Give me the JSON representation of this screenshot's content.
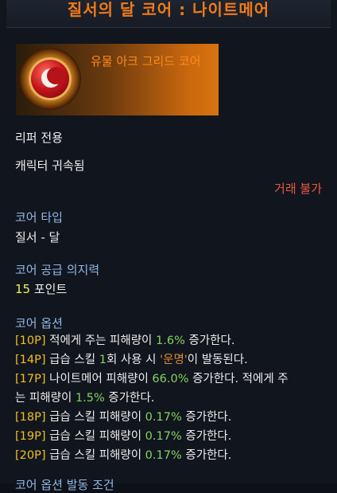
{
  "tooltip": {
    "title": "질서의 달 코어 : 나이트메어",
    "grade": "유물 아크 그리드 코어",
    "class_restriction": "리퍼 전용",
    "binding": "캐릭터 귀속됨",
    "trade": "거래 불가",
    "core_type_label": "코어 타입",
    "core_type_value": "질서 - 달",
    "willpower_label": "코어 공급 의지력",
    "willpower_value": "15",
    "willpower_unit": " 포인트",
    "options_label": "코어 옵션",
    "options": [
      {
        "tier": "[10P]",
        "pre": " 적에게 주는 피해량이 ",
        "num": "1.6%",
        "post": " 증가한다."
      },
      {
        "tier": "[14P]",
        "pre": " 급습 스킬 ",
        "num": "1",
        "mid": "회 사용 시 ",
        "quote": "'운명'",
        "post": "이 발동된다."
      },
      {
        "tier": "[17P]",
        "pre": " 나이트메어 피해량이 ",
        "num": "66.0%",
        "post": " 증가한다. 적에게 주",
        "line2_pre": "는 피해량이 ",
        "num2": "1.5%",
        "line2_post": " 증가한다."
      },
      {
        "tier": "[18P]",
        "pre": " 급습 스킬 피해량이 ",
        "num": "0.17%",
        "post": " 증가한다."
      },
      {
        "tier": "[19P]",
        "pre": " 급습 스킬 피해량이 ",
        "num": "0.17%",
        "post": " 증가한다."
      },
      {
        "tier": "[20P]",
        "pre": " 급습 스킬 피해량이 ",
        "num": "0.17%",
        "post": " 증가한다."
      }
    ],
    "next_section_label": "코어 옵션 발동 조건"
  },
  "colors": {
    "title": "#f07a1a",
    "grade": "#ff8a1a",
    "section": "#8fb8e8",
    "trade": "#e8593f",
    "tier": "#f0c020",
    "number": "#7fd660",
    "points": "#f2f25a"
  },
  "icons": {
    "core": "crescent-moon-core-icon"
  }
}
